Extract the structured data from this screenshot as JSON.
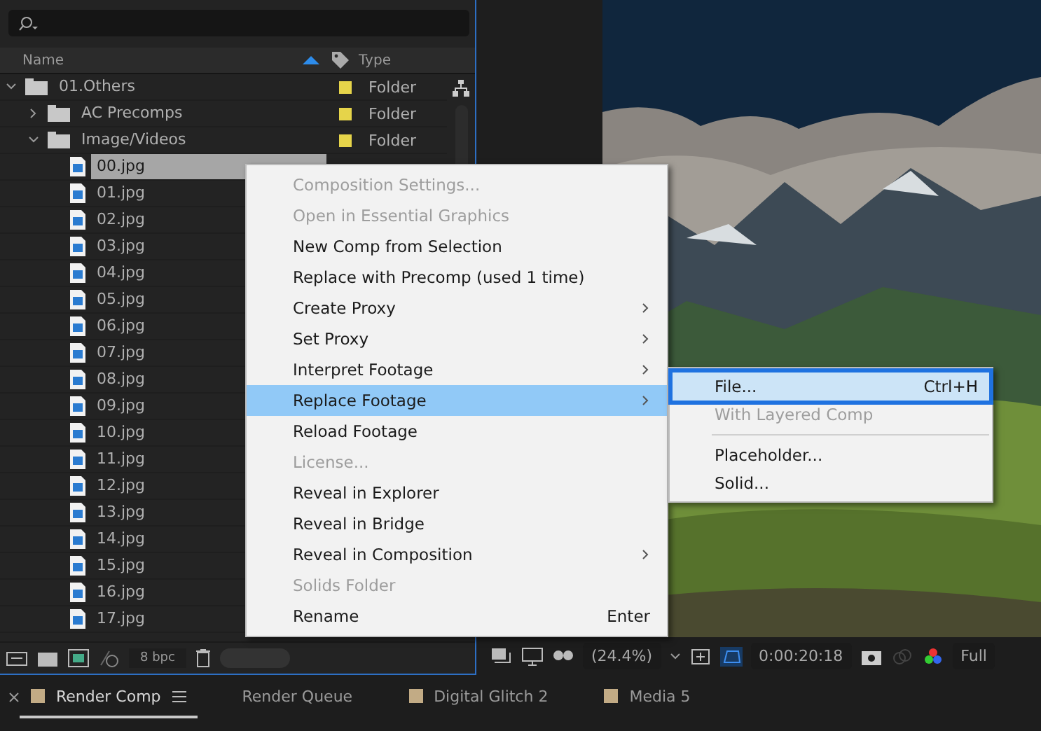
{
  "project": {
    "columns": [
      {
        "label": "Name",
        "sorted": true
      },
      {
        "label": "Type"
      }
    ],
    "tree": [
      {
        "name": "01.Others",
        "kind": "folder",
        "expanded": true,
        "color": "#e6d44a",
        "type": "Folder",
        "children": [
          {
            "name": "AC Precomps",
            "kind": "folder",
            "expanded": false,
            "color": "#e6d44a",
            "type": "Folder"
          },
          {
            "name": "Image/Videos",
            "kind": "folder",
            "expanded": true,
            "color": "#e6d44a",
            "type": "Folder",
            "children": [
              {
                "name": "00.jpg",
                "kind": "file",
                "selected": true
              },
              {
                "name": "01.jpg",
                "kind": "file",
                "selected": false
              },
              {
                "name": "02.jpg",
                "kind": "file",
                "selected": false
              },
              {
                "name": "03.jpg",
                "kind": "file",
                "selected": false
              },
              {
                "name": "04.jpg",
                "kind": "file",
                "selected": false
              },
              {
                "name": "05.jpg",
                "kind": "file",
                "selected": false
              },
              {
                "name": "06.jpg",
                "kind": "file",
                "selected": false
              },
              {
                "name": "07.jpg",
                "kind": "file",
                "selected": false
              },
              {
                "name": "08.jpg",
                "kind": "file",
                "selected": false
              },
              {
                "name": "09.jpg",
                "kind": "file",
                "selected": false
              },
              {
                "name": "10.jpg",
                "kind": "file",
                "selected": false
              },
              {
                "name": "11.jpg",
                "kind": "file",
                "selected": false
              },
              {
                "name": "12.jpg",
                "kind": "file",
                "selected": false
              },
              {
                "name": "13.jpg",
                "kind": "file",
                "selected": false
              },
              {
                "name": "14.jpg",
                "kind": "file",
                "selected": false
              },
              {
                "name": "15.jpg",
                "kind": "file",
                "selected": false
              },
              {
                "name": "16.jpg",
                "kind": "file",
                "selected": false
              },
              {
                "name": "17.jpg",
                "kind": "file",
                "selected": false
              }
            ]
          }
        ]
      }
    ],
    "bit_depth": "8 bpc"
  },
  "viewer": {
    "zoom": "(24.4%)",
    "timecode": "0:00:20:18",
    "resolution": "Full"
  },
  "context_menu": [
    {
      "label": "Composition Settings...",
      "disabled": true,
      "submenu": false,
      "selected": false
    },
    {
      "label": "Open in Essential Graphics",
      "disabled": true,
      "submenu": false,
      "selected": false
    },
    {
      "label": "New Comp from Selection",
      "disabled": false,
      "submenu": false,
      "selected": false
    },
    {
      "label": "Replace with Precomp (used 1 time)",
      "disabled": false,
      "submenu": false,
      "selected": false
    },
    {
      "label": "Create Proxy",
      "disabled": false,
      "submenu": true,
      "selected": false
    },
    {
      "label": "Set Proxy",
      "disabled": false,
      "submenu": true,
      "selected": false
    },
    {
      "label": "Interpret Footage",
      "disabled": false,
      "submenu": true,
      "selected": false
    },
    {
      "label": "Replace Footage",
      "disabled": false,
      "submenu": true,
      "selected": true
    },
    {
      "label": "Reload Footage",
      "disabled": false,
      "submenu": false,
      "selected": false
    },
    {
      "label": "License...",
      "disabled": true,
      "submenu": false,
      "selected": false
    },
    {
      "label": "Reveal in Explorer",
      "disabled": false,
      "submenu": false,
      "selected": false
    },
    {
      "label": "Reveal in Bridge",
      "disabled": false,
      "submenu": false,
      "selected": false
    },
    {
      "label": "Reveal in Composition",
      "disabled": false,
      "submenu": true,
      "selected": false
    },
    {
      "label": "Solids Folder",
      "disabled": true,
      "submenu": false,
      "selected": false
    },
    {
      "label": "Rename",
      "disabled": false,
      "submenu": false,
      "selected": false,
      "shortcut": "Enter"
    }
  ],
  "submenu": [
    {
      "kind": "item",
      "label": "File...",
      "shortcut": "Ctrl+H",
      "disabled": false,
      "selected": true
    },
    {
      "kind": "item",
      "label": "With Layered Comp",
      "disabled": true,
      "selected": false
    },
    {
      "kind": "separator"
    },
    {
      "kind": "item",
      "label": "Placeholder...",
      "disabled": false,
      "selected": false
    },
    {
      "kind": "item",
      "label": "Solid...",
      "disabled": false,
      "selected": false
    }
  ],
  "tabs": [
    {
      "label": "Render Comp",
      "selected": true,
      "color": "#c2ab85"
    },
    {
      "label": "Render Queue",
      "selected": false
    },
    {
      "label": "Digital Glitch 2",
      "selected": false,
      "color": "#c2ab85"
    },
    {
      "label": "Media 5",
      "selected": false,
      "color": "#c2ab85"
    }
  ]
}
